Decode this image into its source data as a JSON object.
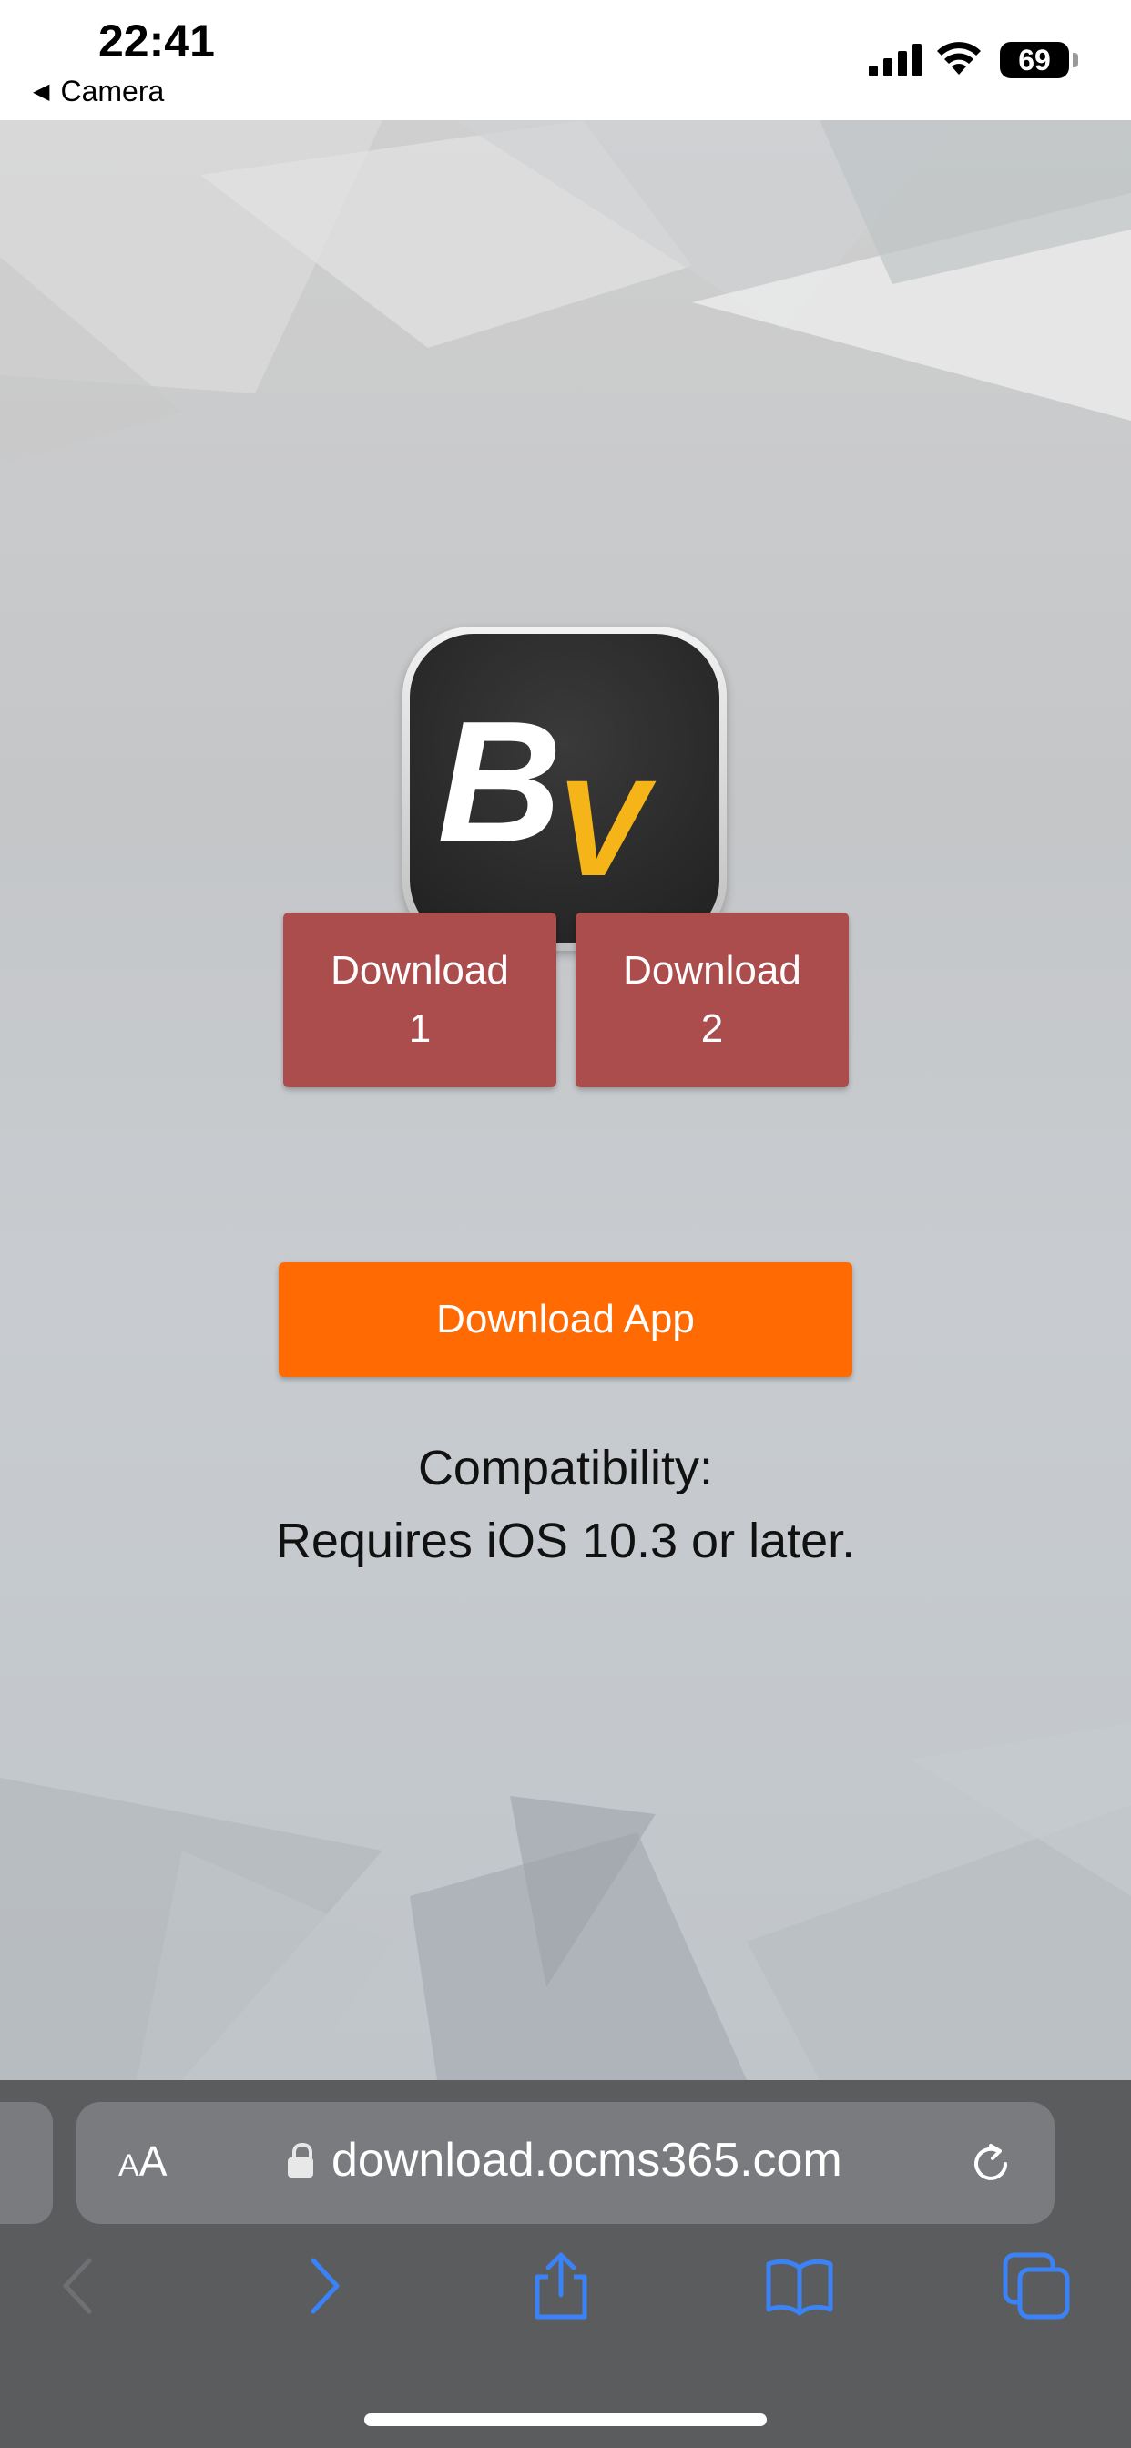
{
  "status_bar": {
    "time": "22:41",
    "back_label": "Camera",
    "battery": "69",
    "icons": [
      "cellular-signal-icon",
      "wifi-icon",
      "battery-icon"
    ]
  },
  "page": {
    "app_icon_text_b": "B",
    "app_icon_text_v": "V",
    "download1_line1": "Download",
    "download1_line2": "1",
    "download2_line1": "Download",
    "download2_line2": "2",
    "download_app": "Download App",
    "compat_title": "Compatibility:",
    "compat_text": "Requires iOS 10.3 or later.",
    "colors": {
      "red_button": "#ab4c4d",
      "orange_button": "#ff6a02",
      "icon_yellow": "#f5b519"
    }
  },
  "browser": {
    "aa_small": "A",
    "aa_large": "A",
    "url": "download.ocms365.com",
    "toolbar": [
      "back-icon",
      "forward-icon",
      "share-icon",
      "bookmarks-icon",
      "tabs-icon"
    ]
  }
}
